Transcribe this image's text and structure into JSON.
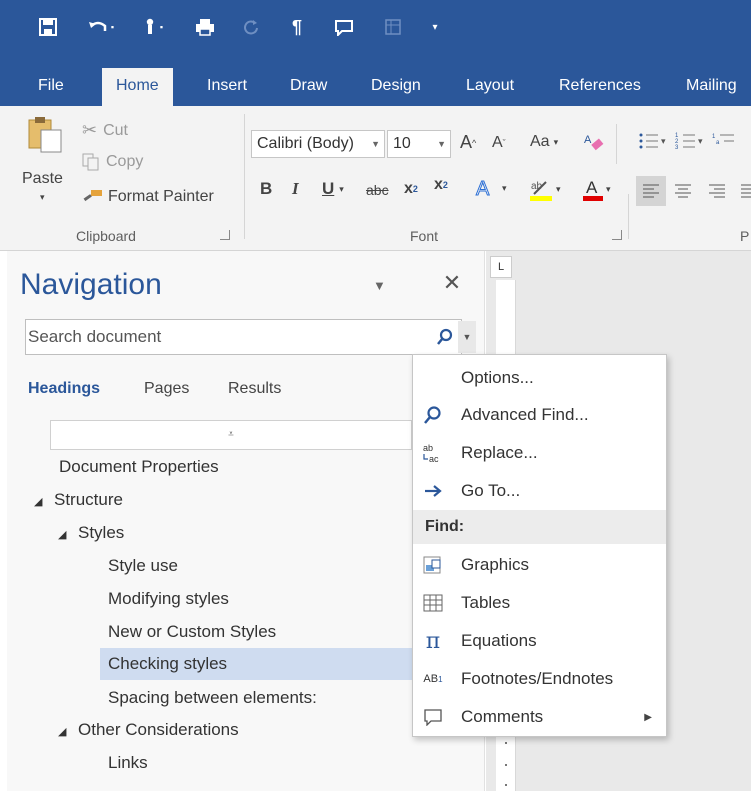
{
  "quick_access": {
    "items": [
      "save-icon",
      "undo-icon",
      "touch-mode-icon",
      "print-icon",
      "redo-icon",
      "paragraph-mark-icon",
      "new-comment-icon",
      "table-icon",
      "customize-qat-icon"
    ]
  },
  "ribbon_tabs": [
    "File",
    "Home",
    "Insert",
    "Draw",
    "Design",
    "Layout",
    "References",
    "Mailing"
  ],
  "clipboard": {
    "paste": "Paste",
    "cut": "Cut",
    "copy": "Copy",
    "format_painter": "Format Painter",
    "label": "Clipboard"
  },
  "font": {
    "font_name": "Calibri (Body)",
    "font_size": "10",
    "change_case": "Aa",
    "label": "Font"
  },
  "paragraph": {
    "label_partial": "P"
  },
  "navigation": {
    "title": "Navigation",
    "search_placeholder": "Search document",
    "tabs": [
      "Headings",
      "Pages",
      "Results"
    ],
    "active_tab": "Headings",
    "tree": [
      {
        "label": "Document Properties",
        "level": 0,
        "expander": false
      },
      {
        "label": "Structure",
        "level": 0,
        "expander": true
      },
      {
        "label": "Styles",
        "level": 1,
        "expander": true
      },
      {
        "label": "Style use",
        "level": 2,
        "expander": false
      },
      {
        "label": "Modifying styles",
        "level": 2,
        "expander": false
      },
      {
        "label": "New or Custom Styles",
        "level": 2,
        "expander": false
      },
      {
        "label": "Checking styles",
        "level": 2,
        "expander": false,
        "selected": true
      },
      {
        "label": "Spacing between elements:",
        "level": 2,
        "expander": false
      },
      {
        "label": "Other Considerations",
        "level": 1,
        "expander": true
      },
      {
        "label": "Links",
        "level": 2,
        "expander": false
      }
    ]
  },
  "search_menu": {
    "options": "Options...",
    "advanced_find": "Advanced Find...",
    "replace": "Replace...",
    "go_to": "Go To...",
    "find_header": "Find:",
    "graphics": "Graphics",
    "tables": "Tables",
    "equations": "Equations",
    "footnotes": "Footnotes/Endnotes",
    "comments": "Comments"
  },
  "colors": {
    "accent": "#2b579a",
    "ribbon_bg": "#f3f3f3",
    "selected_row": "#cfdcf0"
  }
}
